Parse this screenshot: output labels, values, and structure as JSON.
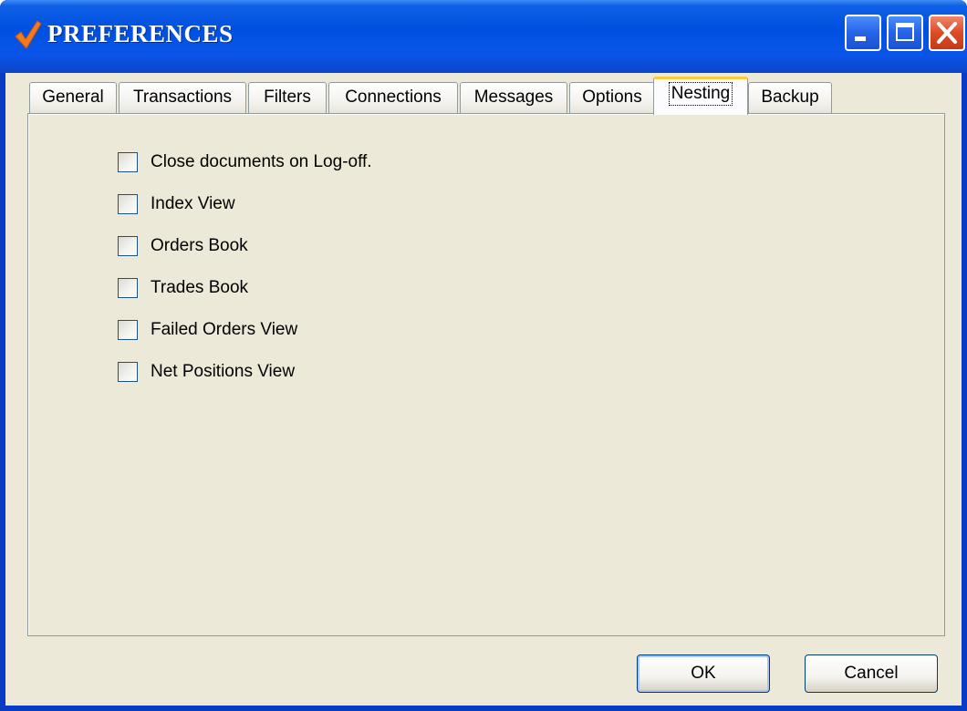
{
  "window": {
    "title": "PREFERENCES",
    "controls": [
      "minimize-icon",
      "maximize-icon",
      "close-icon"
    ]
  },
  "tabs": [
    {
      "label": "General",
      "active": false
    },
    {
      "label": "Transactions",
      "active": false
    },
    {
      "label": "Filters",
      "active": false
    },
    {
      "label": "Connections",
      "active": false
    },
    {
      "label": "Messages",
      "active": false
    },
    {
      "label": "Options",
      "active": false
    },
    {
      "label": "Nesting",
      "active": true
    },
    {
      "label": "Backup",
      "active": false
    }
  ],
  "nesting": {
    "options": [
      {
        "label": "Close documents on Log-off.",
        "checked": false
      },
      {
        "label": "Index View",
        "checked": false
      },
      {
        "label": "Orders Book",
        "checked": false
      },
      {
        "label": "Trades Book",
        "checked": false
      },
      {
        "label": "Failed Orders View",
        "checked": false
      },
      {
        "label": "Net Positions View",
        "checked": false
      }
    ]
  },
  "buttons": {
    "ok_label": "OK",
    "cancel_label": "Cancel"
  },
  "colors": {
    "titlebar": "#0050e0",
    "client_bg": "#ece9d8",
    "active_tab_accent": "#ffc83c",
    "close_button": "#dd4a25",
    "checkmark": "#f47a1f"
  }
}
